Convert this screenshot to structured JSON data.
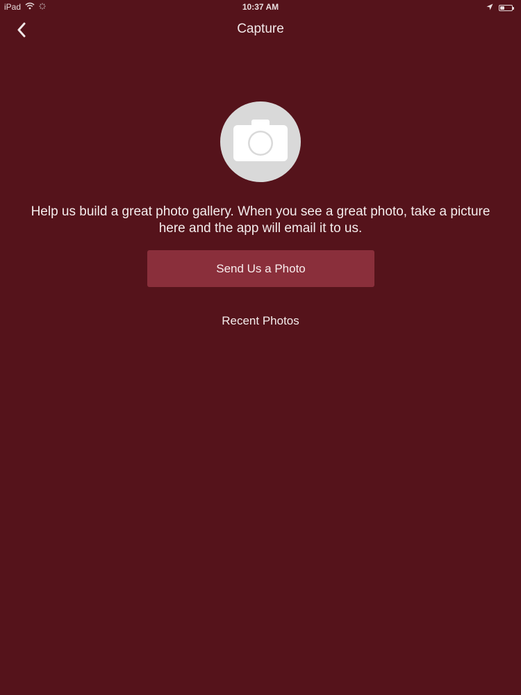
{
  "status_bar": {
    "device": "iPad",
    "time": "10:37 AM",
    "battery_level": 0.35,
    "icons": [
      "wifi-icon",
      "activity-icon",
      "location-arrow-icon",
      "battery-icon"
    ]
  },
  "nav": {
    "title": "Capture",
    "back_icon": "chevron-left-icon"
  },
  "main": {
    "camera_icon": "camera-icon",
    "description": "Help us build a great photo gallery. When you see a great photo, take a picture here and the app will email it to us.",
    "send_button_label": "Send Us a Photo",
    "recent_photos_label": "Recent Photos"
  },
  "colors": {
    "background": "#55131b",
    "button": "#8a2f3b",
    "camera_circle": "#d9d9d9"
  }
}
